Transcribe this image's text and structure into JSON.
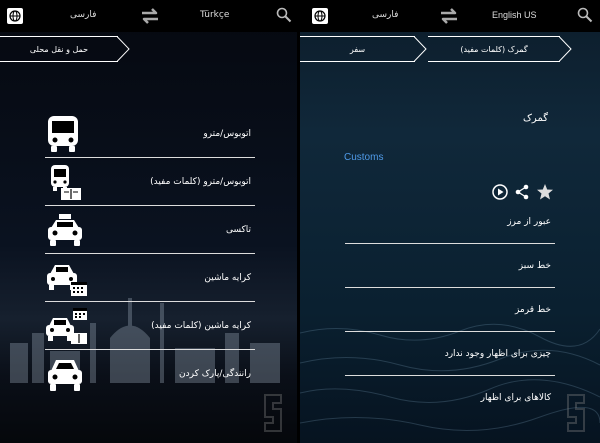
{
  "left": {
    "header": {
      "source_lang": "فارسی",
      "target_lang": "Türkçe"
    },
    "breadcrumb": {
      "current": "حمل و نقل محلی"
    },
    "items": [
      {
        "label": "اتوبوس/مترو",
        "icon": "bus-icon"
      },
      {
        "label": "اتوبوس/مترو (کلمات مفید)",
        "icon": "bus-phrasebook-icon"
      },
      {
        "label": "تاکسی",
        "icon": "taxi-icon"
      },
      {
        "label": "کرایه ماشین",
        "icon": "car-rental-icon"
      },
      {
        "label": "کرایه ماشین (کلمات مفید)",
        "icon": "car-rental-phrasebook-icon"
      },
      {
        "label": "رانندگی/پارک کردن",
        "icon": "car-icon"
      }
    ]
  },
  "right": {
    "header": {
      "source_lang": "فارسی",
      "target_lang": "English US"
    },
    "breadcrumb": {
      "first": "سفر",
      "second": "گمرک (کلمات مفید)"
    },
    "title_fa": "گمرک",
    "title_en": "Customs",
    "items": [
      {
        "label": "عبور از مرز"
      },
      {
        "label": "خط سبز"
      },
      {
        "label": "خط قرمز"
      },
      {
        "label": "چیزی برای اظهار وجود ندارد"
      },
      {
        "label": "کالاهای برای اظهار"
      }
    ]
  },
  "colors": {
    "accent": "#4f9ae8",
    "header": "#000000",
    "text": "#ffffff"
  }
}
